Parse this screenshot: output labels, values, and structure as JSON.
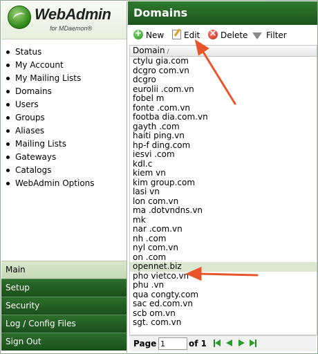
{
  "app": {
    "logo_text": "WebAdmin",
    "logo_subtext": "for MDaemon®"
  },
  "nav": {
    "items": [
      {
        "label": "Status"
      },
      {
        "label": "My Account"
      },
      {
        "label": "My Mailing Lists"
      },
      {
        "label": "Domains"
      },
      {
        "label": "Users"
      },
      {
        "label": "Groups"
      },
      {
        "label": "Aliases"
      },
      {
        "label": "Mailing Lists"
      },
      {
        "label": "Gateways"
      },
      {
        "label": "Catalogs"
      },
      {
        "label": "WebAdmin Options"
      }
    ]
  },
  "sections": [
    {
      "label": "Main",
      "active": true
    },
    {
      "label": "Setup",
      "active": false
    },
    {
      "label": "Security",
      "active": false
    },
    {
      "label": "Log / Config Files",
      "active": false
    },
    {
      "label": "Sign Out",
      "active": false
    }
  ],
  "main": {
    "title": "Domains",
    "toolbar": {
      "new_label": "New",
      "edit_label": "Edit",
      "delete_label": "Delete",
      "filter_label": "Filter"
    },
    "column_header": "Domain",
    "sort_indicator": "/",
    "domains": [
      "ctylu      gia.com",
      "dcgro      com.vn",
      "dcgro      ",
      "eurolii      .com.vn",
      "fobel      m",
      "fonte      .com.vn",
      "footba      dia.com.vn",
      "gayth      .com",
      "haiti      ping.vn",
      "hp-f      ding.com",
      "iesvi      .com",
      "kdl.c      ",
      "kiem      vn",
      "kim      group.com",
      "lasi      vn",
      "lon      com.vn",
      "ma      .dotvndns.vn",
      "mk      ",
      "nar      .com.vn",
      "nh      .com",
      "nyl      com.vn",
      "on      .com",
      "opennet.biz",
      "pho      vietco.vn",
      "phu      .vn",
      "qua      congty.com",
      "sac      ed.com.vn",
      "scb      om.vn",
      "sgt.      com.vn"
    ],
    "selected_domain": "opennet.biz",
    "pager": {
      "page_label": "Page",
      "page_value": "1",
      "of_label": "of 1"
    }
  },
  "colors": {
    "header_green": "#1c541c",
    "selected_row": "#dbe8cf",
    "annotation_arrow": "#e8552a"
  },
  "icons": [
    "new-icon",
    "edit-icon",
    "delete-icon",
    "filter-icon",
    "first-page-icon",
    "prev-page-icon",
    "next-page-icon",
    "last-page-icon",
    "webadmin-logo-icon"
  ]
}
